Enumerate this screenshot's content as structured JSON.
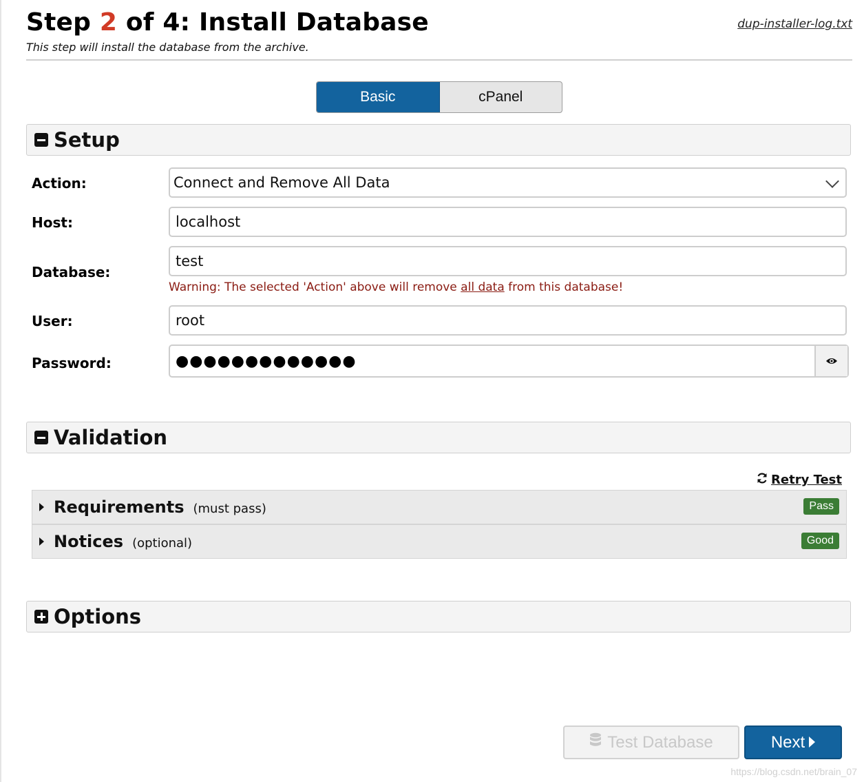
{
  "header": {
    "title_prefix": "Step ",
    "step_current": "2",
    "title_suffix": " of 4: Install Database",
    "subtitle": "This step will install the database from the archive.",
    "log_link": "dup-installer-log.txt"
  },
  "mode_tabs": [
    {
      "label": "Basic",
      "active": true
    },
    {
      "label": "cPanel",
      "active": false
    }
  ],
  "setup": {
    "title": "Setup",
    "action": {
      "label": "Action:",
      "value": "Connect and Remove All Data"
    },
    "host": {
      "label": "Host:",
      "value": "localhost"
    },
    "database": {
      "label": "Database:",
      "value": "test",
      "warning_before": "Warning: The selected 'Action' above will remove ",
      "warning_emphasis": "all data",
      "warning_after": " from this database!"
    },
    "user": {
      "label": "User:",
      "value": "root"
    },
    "password": {
      "label": "Password:",
      "masked_value": "●●●●●●●●●●●●●"
    }
  },
  "validation": {
    "title": "Validation",
    "retry_label": " Retry Test",
    "rows": [
      {
        "title": "Requirements",
        "note": "(must pass)",
        "badge": "Pass"
      },
      {
        "title": "Notices",
        "note": "(optional)",
        "badge": "Good"
      }
    ]
  },
  "options": {
    "title": "Options"
  },
  "footer": {
    "test_button": "Test Database",
    "next_button": "Next",
    "watermark": "https://blog.csdn.net/brain_07"
  },
  "colors": {
    "accent": "#13639e",
    "step_number": "#d13b26",
    "badge_green": "#3b7d35",
    "warning_text": "#8a1b12"
  }
}
